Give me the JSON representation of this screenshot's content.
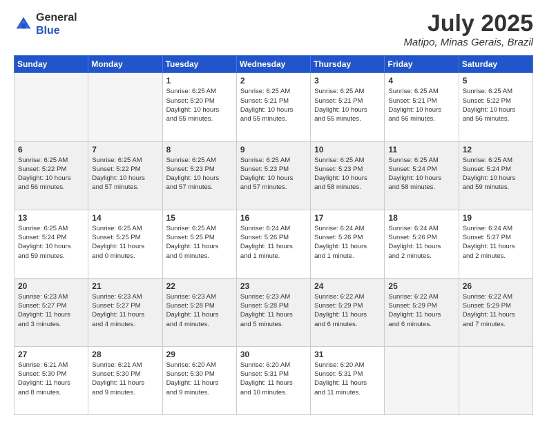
{
  "header": {
    "logo_line1": "General",
    "logo_line2": "Blue",
    "title": "July 2025",
    "location": "Matipo, Minas Gerais, Brazil"
  },
  "days_of_week": [
    "Sunday",
    "Monday",
    "Tuesday",
    "Wednesday",
    "Thursday",
    "Friday",
    "Saturday"
  ],
  "weeks": [
    [
      {
        "day": "",
        "info": ""
      },
      {
        "day": "",
        "info": ""
      },
      {
        "day": "1",
        "info": "Sunrise: 6:25 AM\nSunset: 5:20 PM\nDaylight: 10 hours\nand 55 minutes."
      },
      {
        "day": "2",
        "info": "Sunrise: 6:25 AM\nSunset: 5:21 PM\nDaylight: 10 hours\nand 55 minutes."
      },
      {
        "day": "3",
        "info": "Sunrise: 6:25 AM\nSunset: 5:21 PM\nDaylight: 10 hours\nand 55 minutes."
      },
      {
        "day": "4",
        "info": "Sunrise: 6:25 AM\nSunset: 5:21 PM\nDaylight: 10 hours\nand 56 minutes."
      },
      {
        "day": "5",
        "info": "Sunrise: 6:25 AM\nSunset: 5:22 PM\nDaylight: 10 hours\nand 56 minutes."
      }
    ],
    [
      {
        "day": "6",
        "info": "Sunrise: 6:25 AM\nSunset: 5:22 PM\nDaylight: 10 hours\nand 56 minutes."
      },
      {
        "day": "7",
        "info": "Sunrise: 6:25 AM\nSunset: 5:22 PM\nDaylight: 10 hours\nand 57 minutes."
      },
      {
        "day": "8",
        "info": "Sunrise: 6:25 AM\nSunset: 5:23 PM\nDaylight: 10 hours\nand 57 minutes."
      },
      {
        "day": "9",
        "info": "Sunrise: 6:25 AM\nSunset: 5:23 PM\nDaylight: 10 hours\nand 57 minutes."
      },
      {
        "day": "10",
        "info": "Sunrise: 6:25 AM\nSunset: 5:23 PM\nDaylight: 10 hours\nand 58 minutes."
      },
      {
        "day": "11",
        "info": "Sunrise: 6:25 AM\nSunset: 5:24 PM\nDaylight: 10 hours\nand 58 minutes."
      },
      {
        "day": "12",
        "info": "Sunrise: 6:25 AM\nSunset: 5:24 PM\nDaylight: 10 hours\nand 59 minutes."
      }
    ],
    [
      {
        "day": "13",
        "info": "Sunrise: 6:25 AM\nSunset: 5:24 PM\nDaylight: 10 hours\nand 59 minutes."
      },
      {
        "day": "14",
        "info": "Sunrise: 6:25 AM\nSunset: 5:25 PM\nDaylight: 11 hours\nand 0 minutes."
      },
      {
        "day": "15",
        "info": "Sunrise: 6:25 AM\nSunset: 5:25 PM\nDaylight: 11 hours\nand 0 minutes."
      },
      {
        "day": "16",
        "info": "Sunrise: 6:24 AM\nSunset: 5:26 PM\nDaylight: 11 hours\nand 1 minute."
      },
      {
        "day": "17",
        "info": "Sunrise: 6:24 AM\nSunset: 5:26 PM\nDaylight: 11 hours\nand 1 minute."
      },
      {
        "day": "18",
        "info": "Sunrise: 6:24 AM\nSunset: 5:26 PM\nDaylight: 11 hours\nand 2 minutes."
      },
      {
        "day": "19",
        "info": "Sunrise: 6:24 AM\nSunset: 5:27 PM\nDaylight: 11 hours\nand 2 minutes."
      }
    ],
    [
      {
        "day": "20",
        "info": "Sunrise: 6:23 AM\nSunset: 5:27 PM\nDaylight: 11 hours\nand 3 minutes."
      },
      {
        "day": "21",
        "info": "Sunrise: 6:23 AM\nSunset: 5:27 PM\nDaylight: 11 hours\nand 4 minutes."
      },
      {
        "day": "22",
        "info": "Sunrise: 6:23 AM\nSunset: 5:28 PM\nDaylight: 11 hours\nand 4 minutes."
      },
      {
        "day": "23",
        "info": "Sunrise: 6:23 AM\nSunset: 5:28 PM\nDaylight: 11 hours\nand 5 minutes."
      },
      {
        "day": "24",
        "info": "Sunrise: 6:22 AM\nSunset: 5:29 PM\nDaylight: 11 hours\nand 6 minutes."
      },
      {
        "day": "25",
        "info": "Sunrise: 6:22 AM\nSunset: 5:29 PM\nDaylight: 11 hours\nand 6 minutes."
      },
      {
        "day": "26",
        "info": "Sunrise: 6:22 AM\nSunset: 5:29 PM\nDaylight: 11 hours\nand 7 minutes."
      }
    ],
    [
      {
        "day": "27",
        "info": "Sunrise: 6:21 AM\nSunset: 5:30 PM\nDaylight: 11 hours\nand 8 minutes."
      },
      {
        "day": "28",
        "info": "Sunrise: 6:21 AM\nSunset: 5:30 PM\nDaylight: 11 hours\nand 9 minutes."
      },
      {
        "day": "29",
        "info": "Sunrise: 6:20 AM\nSunset: 5:30 PM\nDaylight: 11 hours\nand 9 minutes."
      },
      {
        "day": "30",
        "info": "Sunrise: 6:20 AM\nSunset: 5:31 PM\nDaylight: 11 hours\nand 10 minutes."
      },
      {
        "day": "31",
        "info": "Sunrise: 6:20 AM\nSunset: 5:31 PM\nDaylight: 11 hours\nand 11 minutes."
      },
      {
        "day": "",
        "info": ""
      },
      {
        "day": "",
        "info": ""
      }
    ]
  ]
}
